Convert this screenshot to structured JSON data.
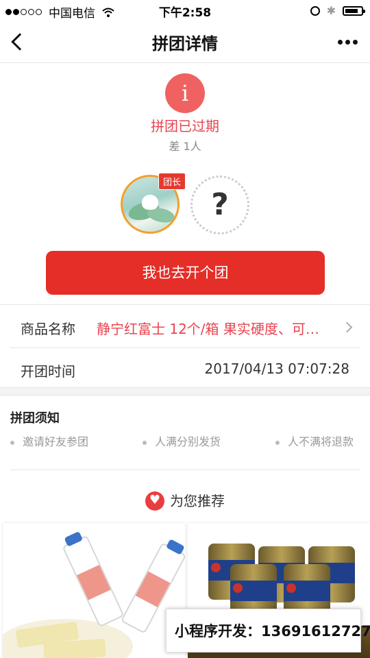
{
  "status_bar": {
    "carrier": "中国电信",
    "time": "下午2:58"
  },
  "nav": {
    "title": "拼团详情"
  },
  "group_status": {
    "icon": "info-icon",
    "icon_glyph": "i",
    "status": "拼团已过期",
    "missing": "差 1人",
    "leader_badge": "团长",
    "placeholder_glyph": "?"
  },
  "actions": {
    "join_button": "我也去开个团"
  },
  "details": {
    "product_label": "商品名称",
    "product_value": "静宁红富士 12个/箱 果实硬度、可…",
    "time_label": "开团时间",
    "time_value": "2017/04/13 07:07:28"
  },
  "notice": {
    "title": "拼团须知",
    "items": [
      "邀请好友参团",
      "人满分别发货",
      "人不满将退款"
    ]
  },
  "recommend": {
    "title": "为您推荐"
  },
  "watermark": {
    "text": "小程序开发：13691612727"
  },
  "colors": {
    "accent_red": "#e52e27",
    "status_red": "#e9434f",
    "icon_red": "#f06262",
    "badge_orange": "#f2a02a"
  }
}
